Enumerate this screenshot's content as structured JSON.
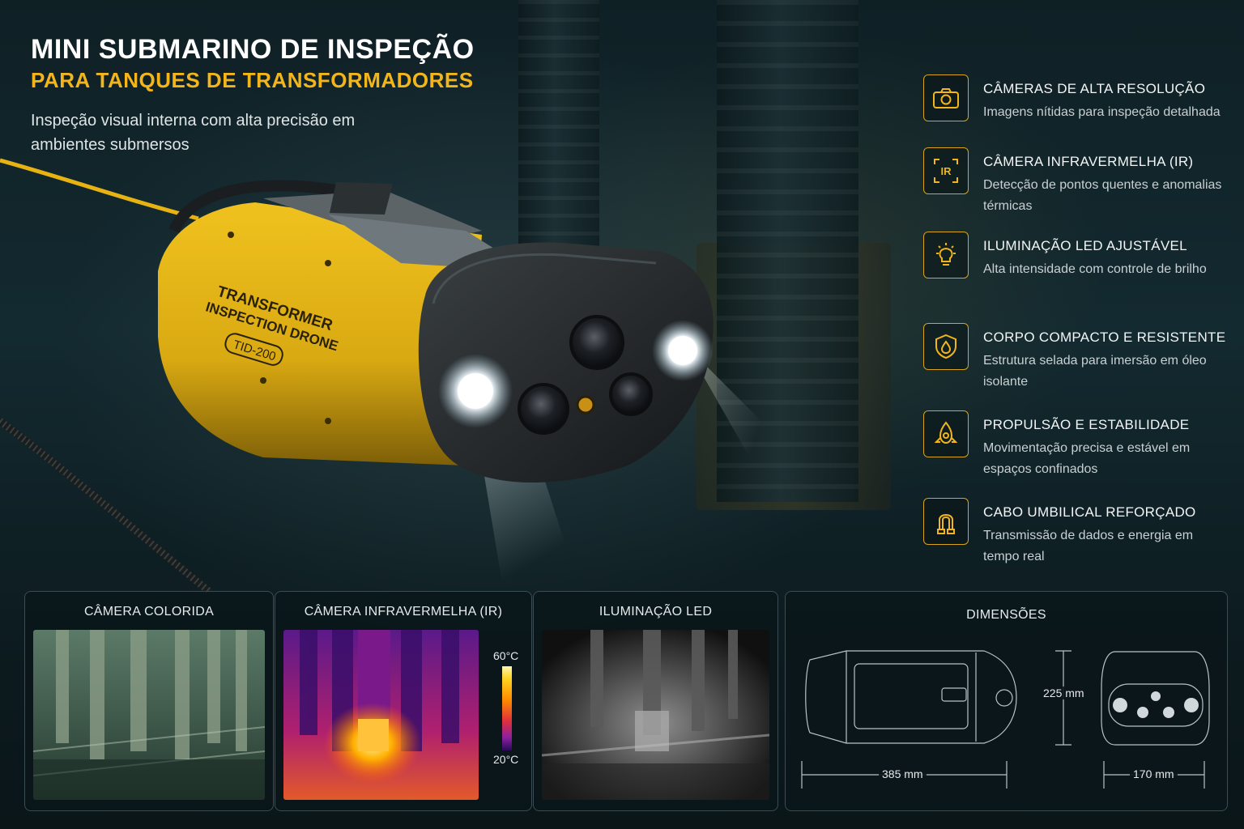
{
  "header": {
    "title": "MINI SUBMARINO DE INSPEÇÃO",
    "subtitle": "PARA TANQUES DE TRANSFORMADORES",
    "description": "Inspeção visual interna com alta precisão em ambientes submersos"
  },
  "drone": {
    "label_line1": "TRANSFORMER",
    "label_line2": "INSPECTION DRONE",
    "model": "TID-200"
  },
  "features": [
    {
      "icon": "camera-icon",
      "title": "CÂMERAS DE ALTA RESOLUÇÃO",
      "desc": "Imagens nítidas para inspeção detalhada"
    },
    {
      "icon": "infrared-icon",
      "title": "CÂMERA INFRAVERMELHA (IR)",
      "desc": "Detecção de pontos quentes e anomalias térmicas"
    },
    {
      "icon": "lightbulb-icon",
      "title": "ILUMINAÇÃO LED AJUSTÁVEL",
      "desc": "Alta intensidade com controle de brilho"
    },
    {
      "icon": "shield-drop-icon",
      "title": "CORPO COMPACTO E RESISTENTE",
      "desc": "Estrutura selada para imersão em óleo isolante"
    },
    {
      "icon": "propulsion-icon",
      "title": "PROPULSÃO E ESTABILIDADE",
      "desc": "Movimentação precisa e estável em espaços confinados"
    },
    {
      "icon": "cable-icon",
      "title": "CABO UMBILICAL REFORÇADO",
      "desc": "Transmissão de dados e energia em tempo real"
    }
  ],
  "panels": {
    "color_camera": {
      "title": "CÂMERA COLORIDA"
    },
    "ir_camera": {
      "title": "CÂMERA INFRAVERMELHA (IR)",
      "scale_max": "60°C",
      "scale_min": "20°C"
    },
    "led": {
      "title": "ILUMINAÇÃO LED"
    },
    "dimensions": {
      "title": "DIMENSÕES",
      "length": "385 mm",
      "height": "225 mm",
      "width": "170 mm"
    }
  },
  "colors": {
    "accent": "#f2b51b",
    "hull_yellow": "#e3b21a",
    "background": "#102226"
  }
}
